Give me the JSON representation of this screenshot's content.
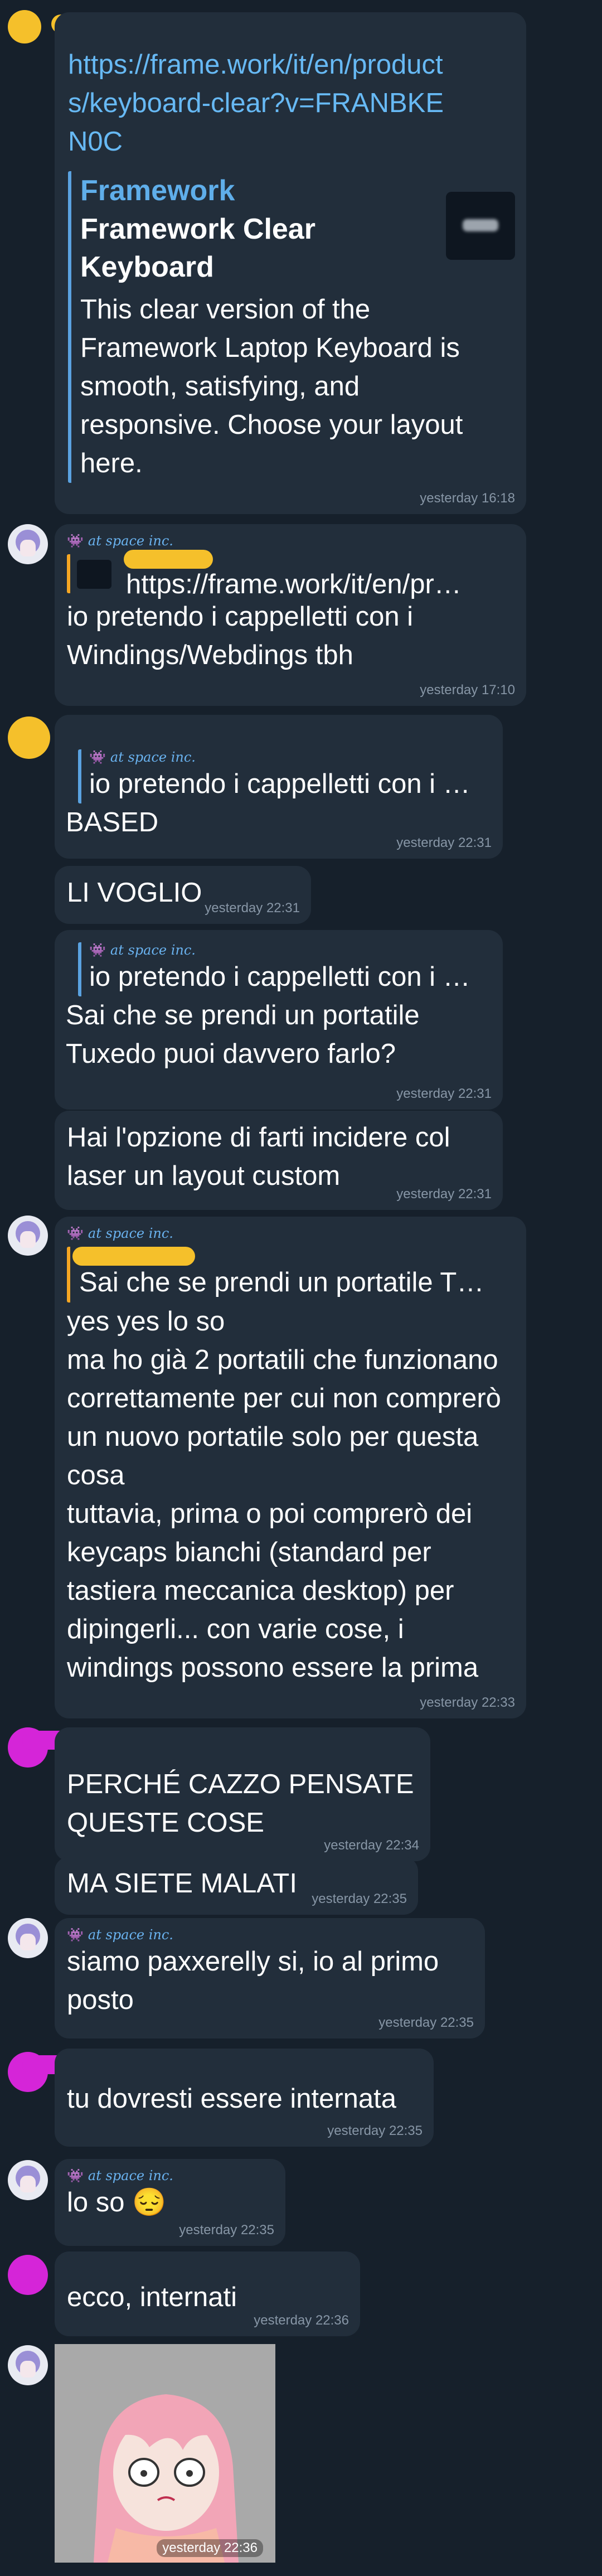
{
  "messages": {
    "link_msg": {
      "url": "https://frame.work/it/en/products/keyboard-clear?v=FRANBKEN0C",
      "preview_site": "Framework",
      "preview_title": "Framework Clear Keyboard",
      "preview_desc": "This clear version of the Framework Laptop Keyboard is smooth, satisfying, and responsive. Choose your layout here.",
      "time": "yesterday 16:18"
    },
    "m2": {
      "sender": "at space inc.",
      "quote_text": "https://frame.work/it/en/pr…",
      "text": "io pretendo i cappelletti con i Windings/Webdings tbh",
      "time": "yesterday 17:10"
    },
    "m3": {
      "quote_sender": "at space inc.",
      "quote_text": "io pretendo i cappelletti con i …",
      "text": "BASED",
      "time": "yesterday 22:31"
    },
    "m4": {
      "text": "LI VOGLIO",
      "time": "yesterday 22:31"
    },
    "m5": {
      "quote_sender": "at space inc.",
      "quote_text": "io pretendo i cappelletti con i …",
      "text": "Sai che se prendi un portatile Tuxedo puoi davvero farlo?",
      "time": "yesterday 22:31"
    },
    "m6": {
      "text": "Hai l'opzione di farti incidere col laser un layout custom",
      "time": "yesterday 22:31"
    },
    "m7": {
      "sender": "at space inc.",
      "quote_text": "Sai che se prendi un portatile T…",
      "text": "yes yes lo so\nma ho già 2 portatili che funzionano correttamente per cui non comprerò un nuovo portatile solo per questa cosa\ntuttavia, prima o poi comprerò dei keycaps bianchi (standard per tastiera meccanica desktop) per dipingerli... con varie cose, i windings possono essere la prima",
      "time": "yesterday 22:33"
    },
    "m8": {
      "text": "PERCHÉ CAZZO PENSATE QUESTE COSE",
      "time": "yesterday 22:34"
    },
    "m9": {
      "text": "MA SIETE MALATI",
      "time": "yesterday 22:35"
    },
    "m10": {
      "sender": "at space inc.",
      "text": "siamo paxxerelly si, io al primo posto",
      "time": "yesterday 22:35"
    },
    "m11": {
      "text": "tu dovresti essere internata",
      "time": "yesterday 22:35"
    },
    "m12": {
      "sender": "at space inc.",
      "text": "lo so",
      "emoji": "😔",
      "time": "yesterday 22:35"
    },
    "m13": {
      "text": "ecco, internati",
      "time": "yesterday 22:36"
    },
    "m14": {
      "time": "yesterday 22:36"
    }
  },
  "icons": {
    "sender_icon": "👾"
  },
  "colors": {
    "background": "#16202b",
    "bubble": "#222e3b",
    "link": "#67b9f4",
    "time": "#8796a6",
    "scribble_orange": "#f5c02b",
    "scribble_magenta": "#d525d8"
  }
}
